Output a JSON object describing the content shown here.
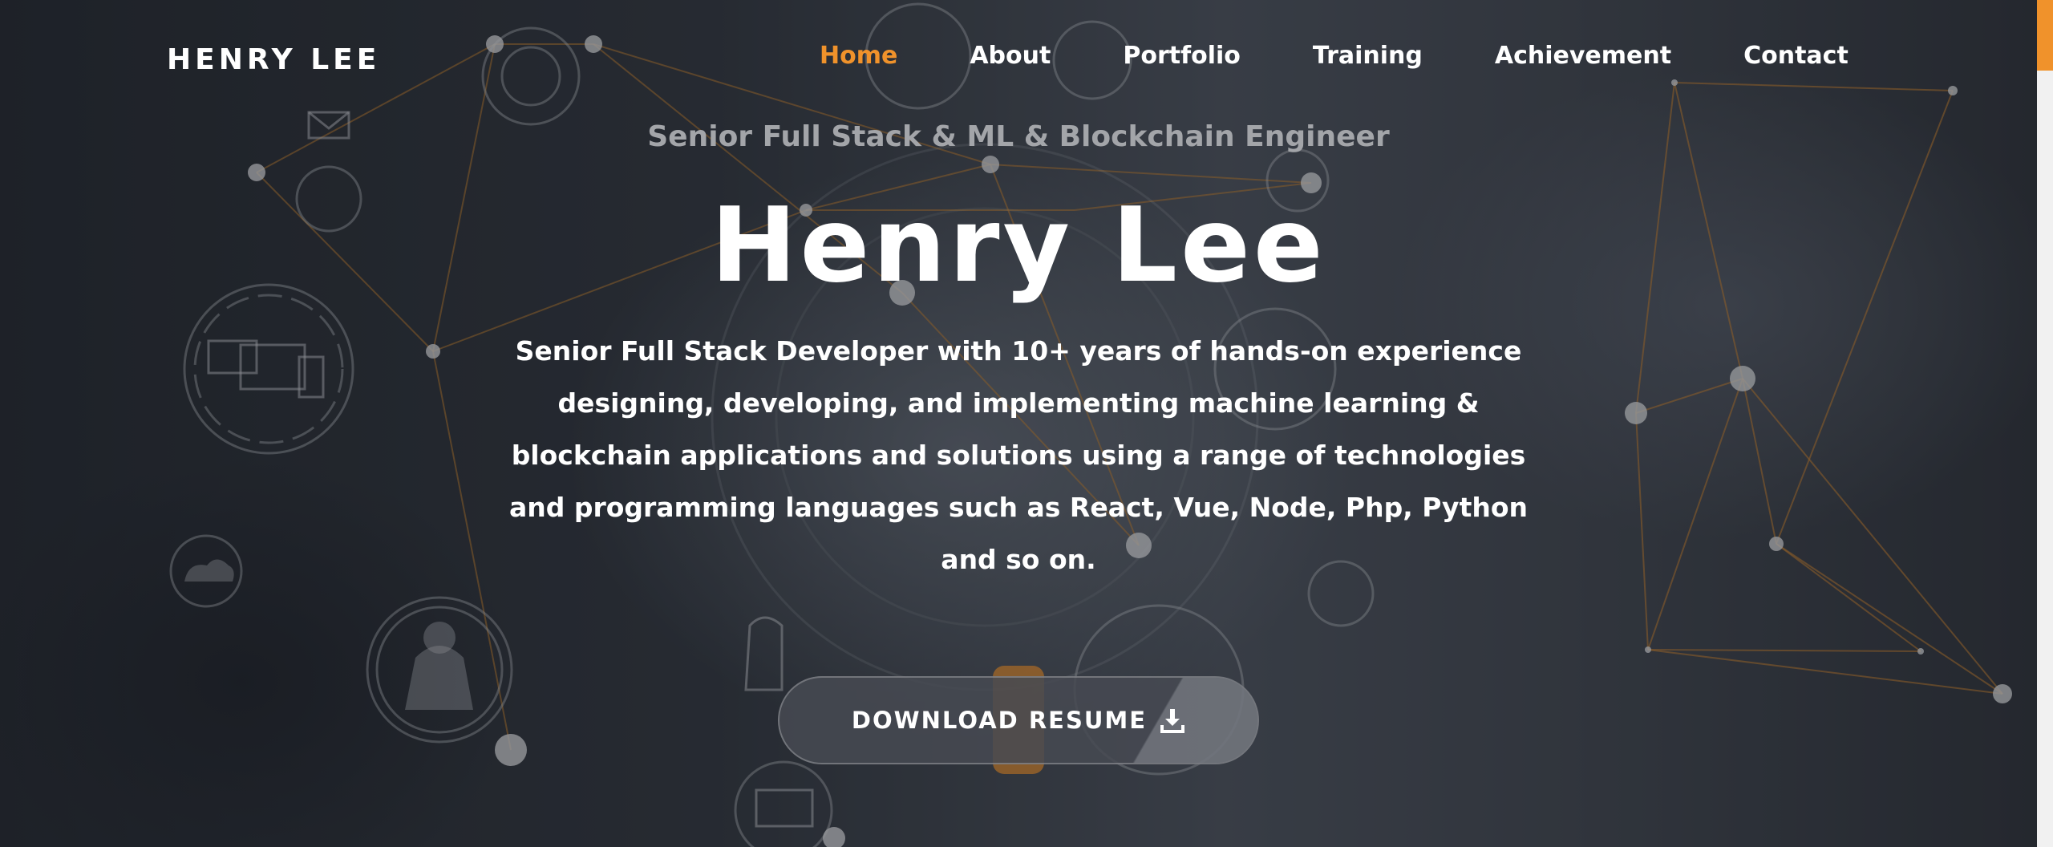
{
  "header": {
    "brand": "HENRY LEE",
    "nav": [
      {
        "label": "Home",
        "active": true
      },
      {
        "label": "About",
        "active": false
      },
      {
        "label": "Portfolio",
        "active": false
      },
      {
        "label": "Training",
        "active": false
      },
      {
        "label": "Achievement",
        "active": false
      },
      {
        "label": "Contact",
        "active": false
      }
    ]
  },
  "hero": {
    "subtitle": "Senior Full Stack & ML & Blockchain Engineer",
    "name": "Henry Lee",
    "description": "Senior Full Stack Developer with 10+ years of hands-on experience designing, developing, and implementing machine learning & blockchain applications and solutions using a range of technologies and programming languages such as React, Vue, Node, Php, Python and so on.",
    "button_label": "DOWNLOAD RESUME",
    "button_icon": "download-icon"
  },
  "colors": {
    "accent": "#f0922b",
    "text": "#ffffff",
    "subtitle": "#a3a5a9",
    "background": "#2b2f37"
  }
}
